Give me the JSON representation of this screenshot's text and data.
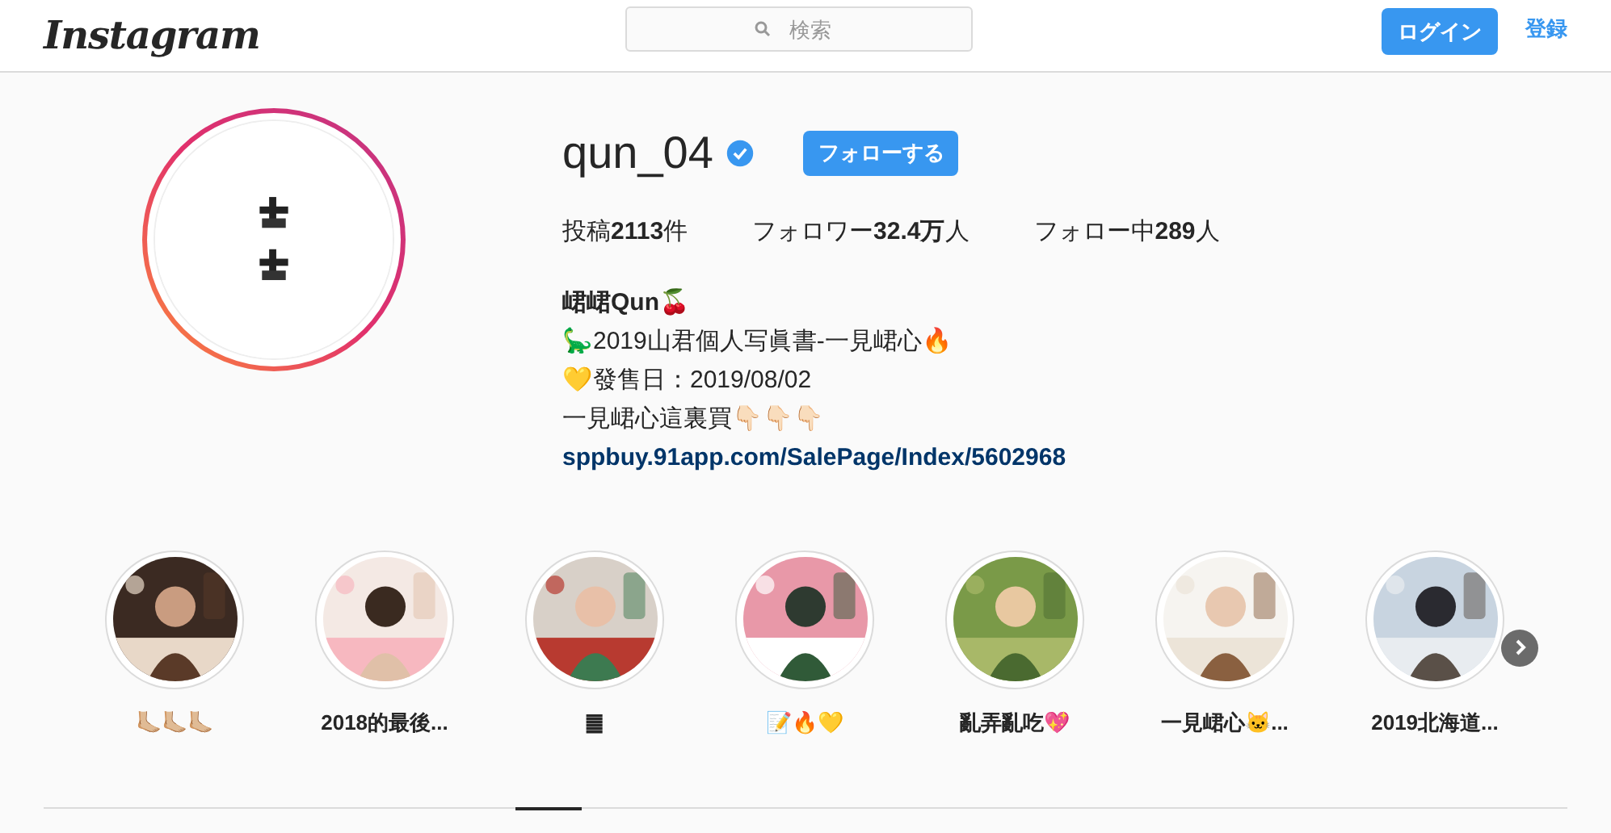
{
  "header": {
    "logo": "Instagram",
    "search": {
      "placeholder": "検索"
    },
    "login_button": "ログイン",
    "signup_link": "登録"
  },
  "profile": {
    "username": "qun_04",
    "verified": true,
    "follow_button": "フォローする",
    "stats": [
      {
        "label": "投稿",
        "value": "2113",
        "unit": "件"
      },
      {
        "label": "フォロワー",
        "value": "32.4万",
        "unit": "人"
      },
      {
        "label": "フォロー中",
        "value": "289",
        "unit": "人"
      }
    ],
    "name": "峮峮Qun🍒",
    "bio": [
      "🦕2019山君個人写眞書-一見峮心🔥",
      "💛發售日：2019/08/02",
      "一見峮心這裏買👇🏻👇🏻👇🏻"
    ],
    "link": "sppbuy.91app.com/SalePage/Index/5602968"
  },
  "highlights": [
    {
      "title": "🦶🏼🦶🏼🦶🏼"
    },
    {
      "title": "2018的最後..."
    },
    {
      "title": "䷀"
    },
    {
      "title": "📝🔥💛"
    },
    {
      "title": "亂弄亂吃💖"
    },
    {
      "title": "一見峮心🐱..."
    },
    {
      "title": "2019北海道..."
    }
  ],
  "tabs": [
    {
      "selected": true
    }
  ]
}
